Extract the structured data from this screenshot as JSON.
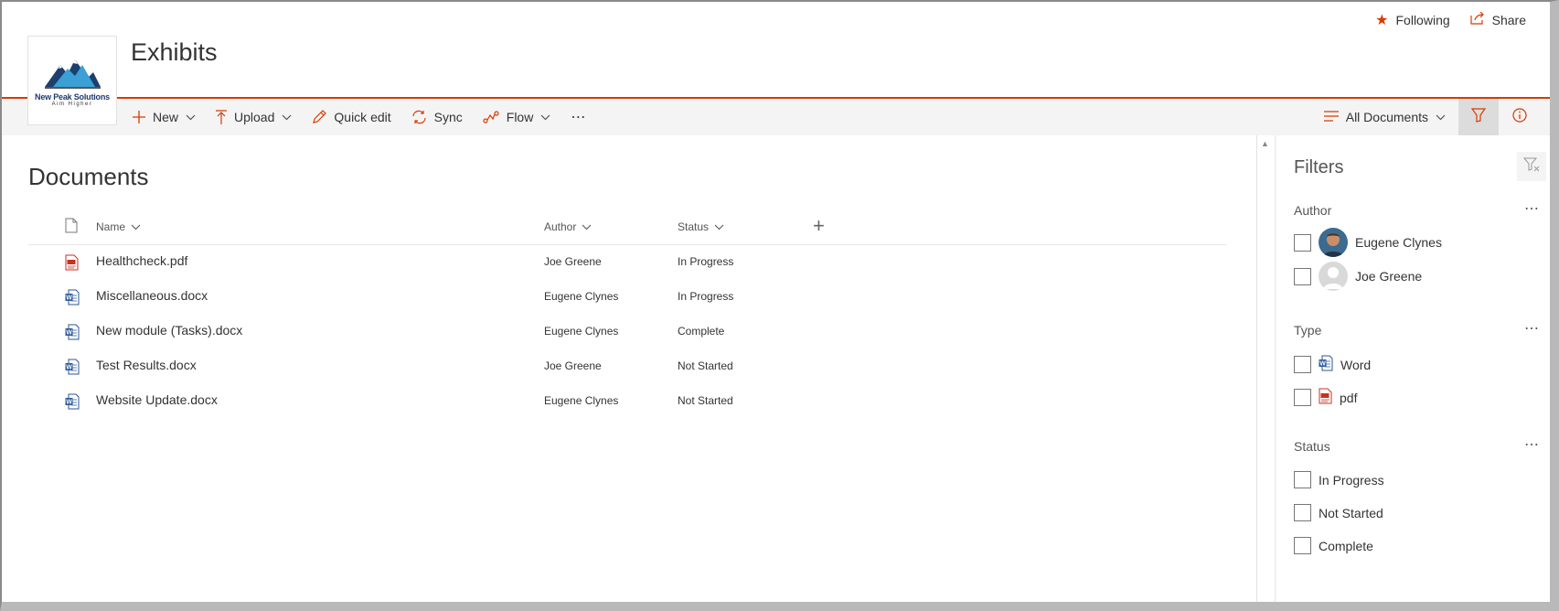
{
  "header": {
    "site_title": "Exhibits",
    "logo_name": "New Peak Solutions",
    "logo_tagline": "Aim Higher",
    "following_label": "Following",
    "share_label": "Share"
  },
  "commandbar": {
    "new_label": "New",
    "upload_label": "Upload",
    "quick_edit_label": "Quick edit",
    "sync_label": "Sync",
    "flow_label": "Flow",
    "more_label": "⋯",
    "view_label": "All Documents"
  },
  "library": {
    "title": "Documents",
    "columns": {
      "name": "Name",
      "author": "Author",
      "status": "Status"
    },
    "add_column_label": "+",
    "rows": [
      {
        "name": "Healthcheck.pdf",
        "author": "Joe Greene",
        "status": "In Progress",
        "type": "pdf"
      },
      {
        "name": "Miscellaneous.docx",
        "author": "Eugene Clynes",
        "status": "In Progress",
        "type": "word"
      },
      {
        "name": "New module (Tasks).docx",
        "author": "Eugene Clynes",
        "status": "Complete",
        "type": "word"
      },
      {
        "name": "Test Results.docx",
        "author": "Joe Greene",
        "status": "Not Started",
        "type": "word"
      },
      {
        "name": "Website Update.docx",
        "author": "Eugene Clynes",
        "status": "Not Started",
        "type": "word"
      }
    ]
  },
  "filters": {
    "title": "Filters",
    "author": {
      "heading": "Author",
      "options": [
        "Eugene Clynes",
        "Joe Greene"
      ]
    },
    "type": {
      "heading": "Type",
      "options": [
        "Word",
        "pdf"
      ]
    },
    "status": {
      "heading": "Status",
      "options": [
        "In Progress",
        "Not Started",
        "Complete"
      ]
    },
    "more_label": "⋯"
  },
  "colors": {
    "accent": "#d83b01",
    "word_blue": "#2b579a",
    "pdf_red": "#c8321f"
  }
}
